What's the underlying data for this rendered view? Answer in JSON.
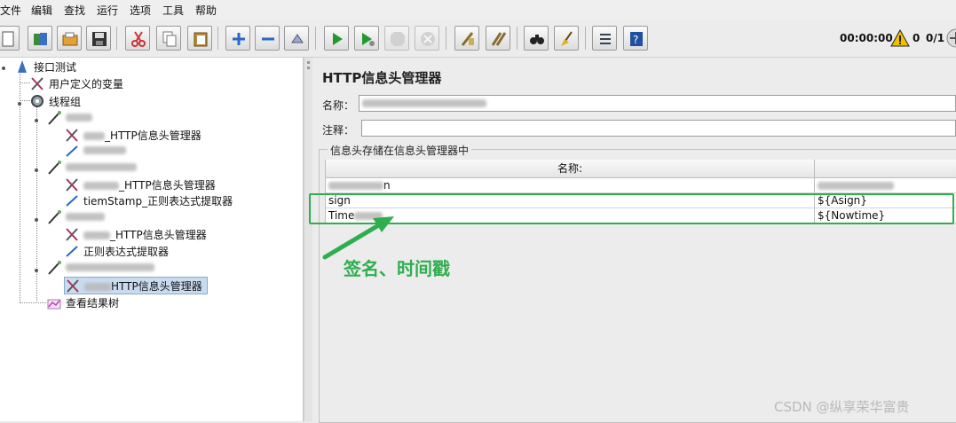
{
  "menubar": [
    "文件",
    "编辑",
    "查找",
    "运行",
    "选项",
    "工具",
    "帮助"
  ],
  "toolbar": {
    "buttons": [
      "new-icon",
      "templates-icon",
      "open-icon",
      "save-icon",
      "cut-icon",
      "copy-icon",
      "paste-icon",
      "expand-icon",
      "collapse-icon",
      "toggle-icon",
      "start-icon",
      "start-no-pause-icon",
      "stop-icon",
      "shutdown-icon",
      "clear-icon",
      "clear-all-icon",
      "search-icon",
      "reset-search-icon",
      "function-helper-icon",
      "help-icon"
    ],
    "timer": "00:00:00",
    "warning_count": "0",
    "thread_ratio": "0/1"
  },
  "tree": {
    "root": "接口测试",
    "udv": "用户定义的变量",
    "thread_group": "线程组",
    "items": [
      {
        "label": "_HTTP信息头管理器"
      },
      {
        "label": "_HTTP信息头管理器"
      },
      {
        "label": "tiemStamp_正则表达式提取器"
      },
      {
        "label": "_HTTP信息头管理器"
      },
      {
        "label": "正则表达式提取器"
      },
      {
        "label": "HTTP信息头管理器"
      }
    ],
    "listener": "查看结果树"
  },
  "panel": {
    "title": "HTTP信息头管理器",
    "name_label": "名称：",
    "comment_label": "注释：",
    "group_title": "信息头存储在信息头管理器中",
    "col_name": "名称:",
    "rows": [
      {
        "name": "n",
        "value": ""
      },
      {
        "name": "sign",
        "value": "${Asign}"
      },
      {
        "name": "Time",
        "value": "${Nowtime}"
      }
    ]
  },
  "annotation": "签名、时间戳",
  "watermark": "CSDN @纵享荣华富贵",
  "colors": {
    "highlight": "#2fae4e",
    "selection": "#c9dbef"
  }
}
